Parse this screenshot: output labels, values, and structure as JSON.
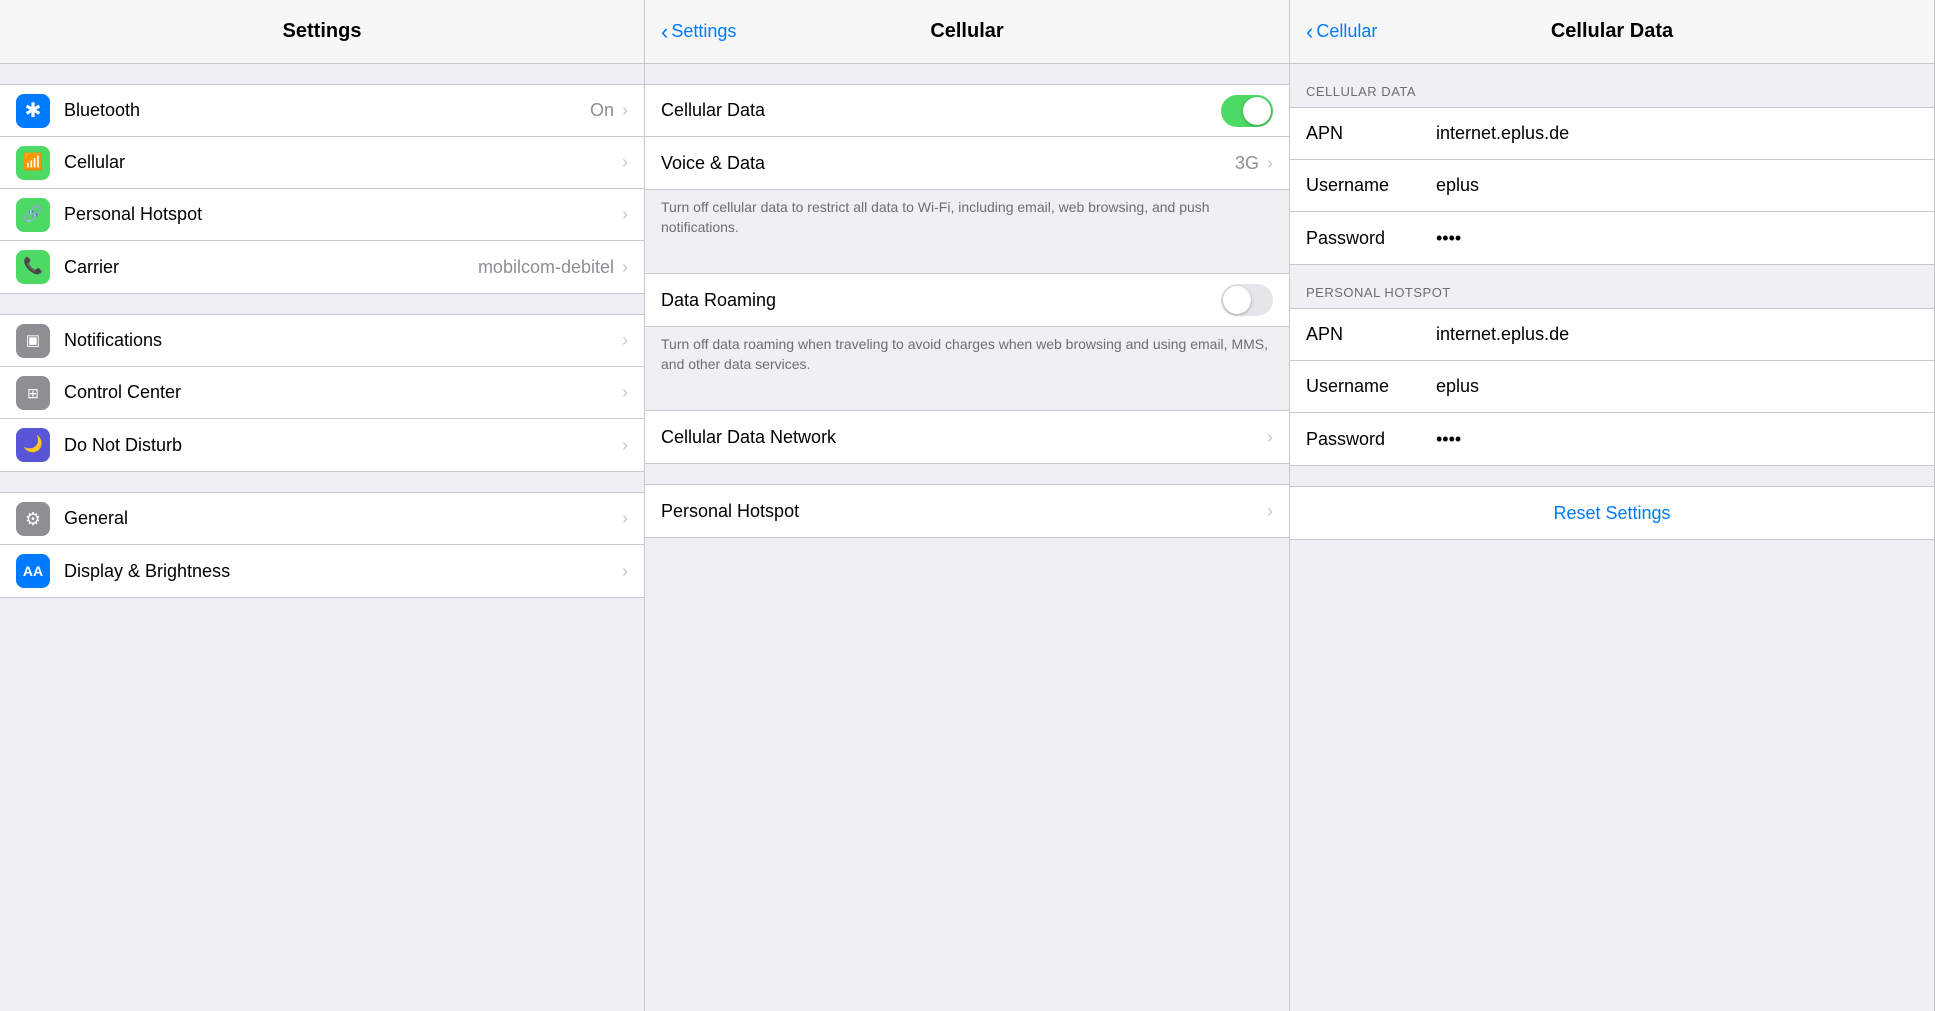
{
  "panel1": {
    "title": "Settings",
    "items_group1": [
      {
        "id": "bluetooth",
        "label": "Bluetooth",
        "value": "On",
        "iconBg": "icon-blue",
        "iconSymbol": "bluetooth"
      },
      {
        "id": "cellular",
        "label": "Cellular",
        "value": "",
        "iconBg": "icon-green",
        "iconSymbol": "cellular"
      },
      {
        "id": "personal_hotspot",
        "label": "Personal Hotspot",
        "value": "",
        "iconBg": "icon-green",
        "iconSymbol": "hotspot"
      },
      {
        "id": "carrier",
        "label": "Carrier",
        "value": "mobilcom-debitel",
        "iconBg": "icon-green",
        "iconSymbol": "phone"
      }
    ],
    "items_group2": [
      {
        "id": "notifications",
        "label": "Notifications",
        "value": "",
        "iconBg": "icon-gray",
        "iconSymbol": "notifications"
      },
      {
        "id": "control_center",
        "label": "Control Center",
        "value": "",
        "iconBg": "icon-gray",
        "iconSymbol": "control_center"
      },
      {
        "id": "do_not_disturb",
        "label": "Do Not Disturb",
        "value": "",
        "iconBg": "icon-purple",
        "iconSymbol": "moon"
      }
    ],
    "items_group3": [
      {
        "id": "general",
        "label": "General",
        "value": "",
        "iconBg": "icon-gray",
        "iconSymbol": "gear"
      },
      {
        "id": "display",
        "label": "Display & Brightness",
        "value": "",
        "iconBg": "icon-blue",
        "iconSymbol": "display"
      }
    ]
  },
  "panel2": {
    "title": "Cellular",
    "back_label": "Settings",
    "cellular_data_label": "Cellular Data",
    "cellular_data_on": true,
    "voice_data_label": "Voice & Data",
    "voice_data_value": "3G",
    "cellular_data_description": "Turn off cellular data to restrict all data to Wi-Fi, including email, web browsing, and push notifications.",
    "data_roaming_label": "Data Roaming",
    "data_roaming_on": false,
    "data_roaming_description": "Turn off data roaming when traveling to avoid charges when web browsing and using email, MMS, and other data services.",
    "cellular_data_network_label": "Cellular Data Network",
    "personal_hotspot_label": "Personal Hotspot"
  },
  "panel3": {
    "title": "Cellular Data",
    "back_label": "Cellular",
    "section_cellular": "Cellular Data",
    "section_hotspot": "Personal Hotspot",
    "cellular_fields": [
      {
        "label": "APN",
        "value": "internet.eplus.de"
      },
      {
        "label": "Username",
        "value": "eplus"
      },
      {
        "label": "Password",
        "value": "••••"
      }
    ],
    "hotspot_fields": [
      {
        "label": "APN",
        "value": "internet.eplus.de"
      },
      {
        "label": "Username",
        "value": "eplus"
      },
      {
        "label": "Password",
        "value": "••••"
      }
    ],
    "reset_label": "Reset Settings"
  }
}
